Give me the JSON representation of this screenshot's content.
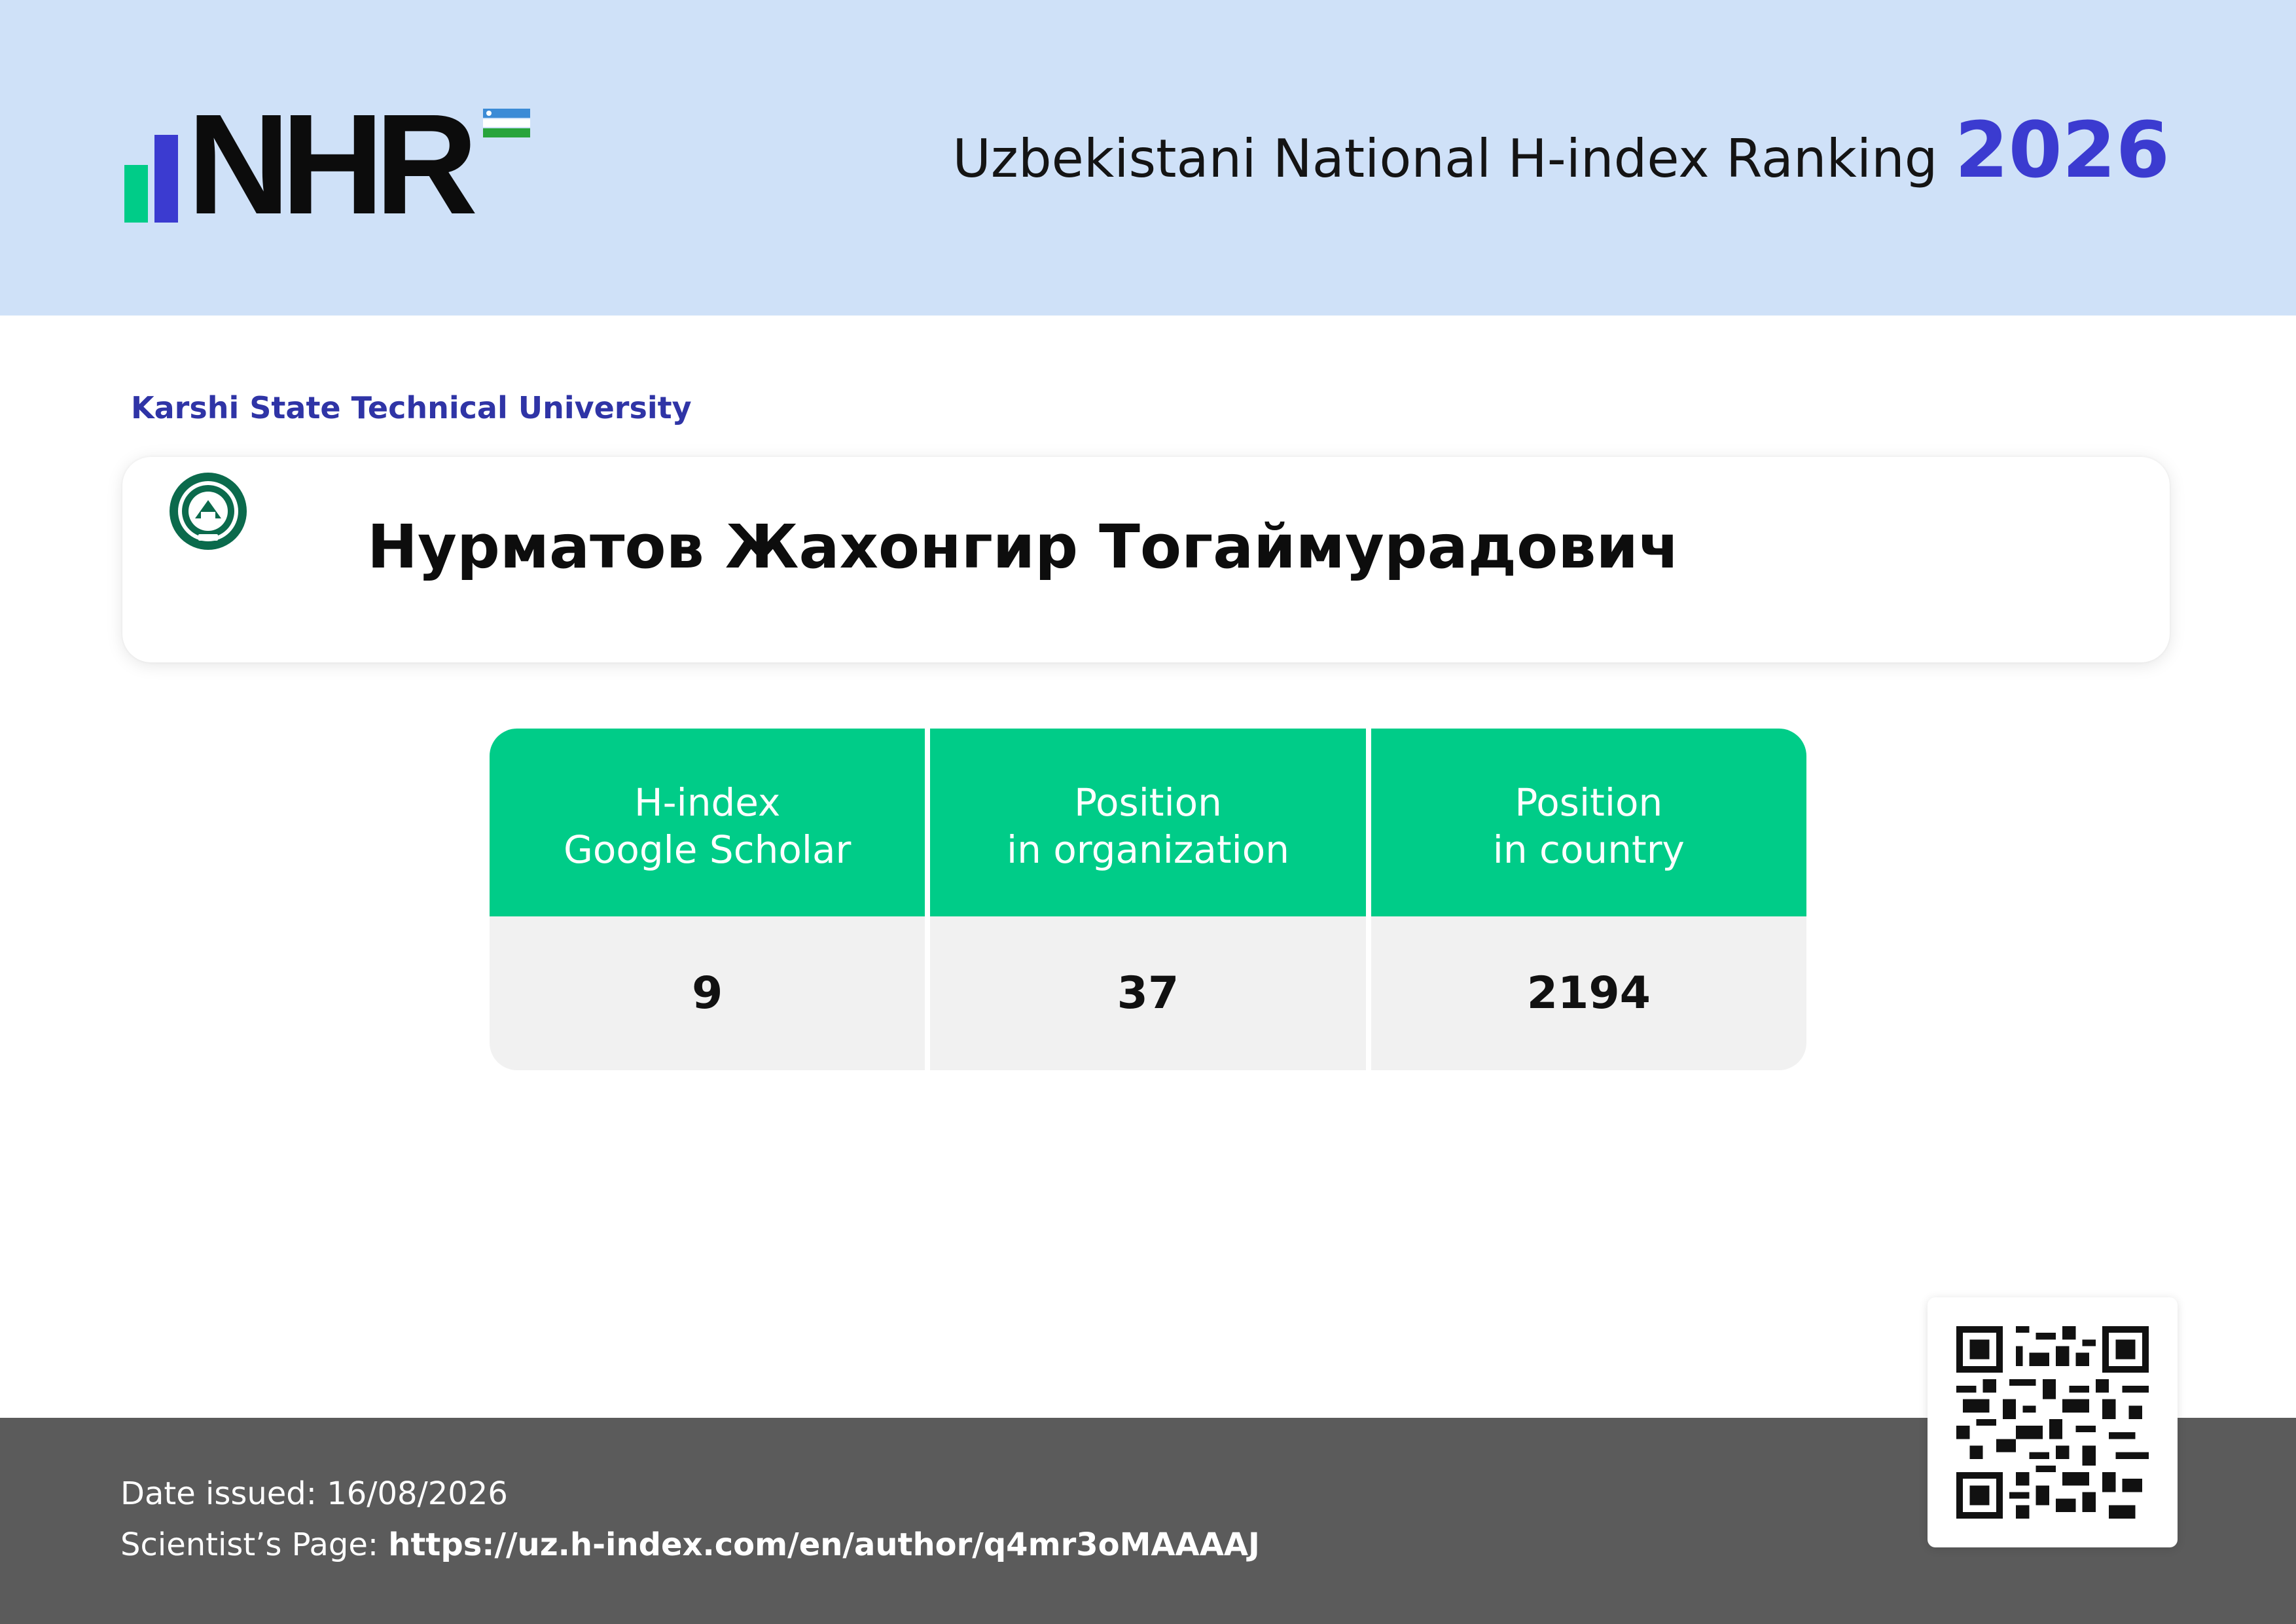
{
  "header": {
    "logo_text": "NHR",
    "title": "Uzbekistani National H-index Ranking",
    "year": "2026"
  },
  "organization": {
    "name": "Karshi State Technical University",
    "seal_icon": "university-seal-icon"
  },
  "scientist": {
    "name": "Нурматов Жахонгир Тогаймурадович"
  },
  "stats": [
    {
      "label_line1": "H-index",
      "label_line2": "Google Scholar",
      "value": "9"
    },
    {
      "label_line1": "Position",
      "label_line2": "in organization",
      "value": "37"
    },
    {
      "label_line1": "Position",
      "label_line2": "in country",
      "value": "2194"
    }
  ],
  "footer": {
    "date_label": "Date issued:",
    "date_value": "16/08/2026",
    "page_label": "Scientist’s Page:",
    "page_url": "https://uz.h-index.com/en/author/q4mr3oMAAAAJ"
  },
  "colors": {
    "header_bg": "#cfe1f8",
    "accent_blue": "#3b3bd0",
    "accent_green": "#00cc88",
    "footer_bg": "#5b5b5b"
  }
}
